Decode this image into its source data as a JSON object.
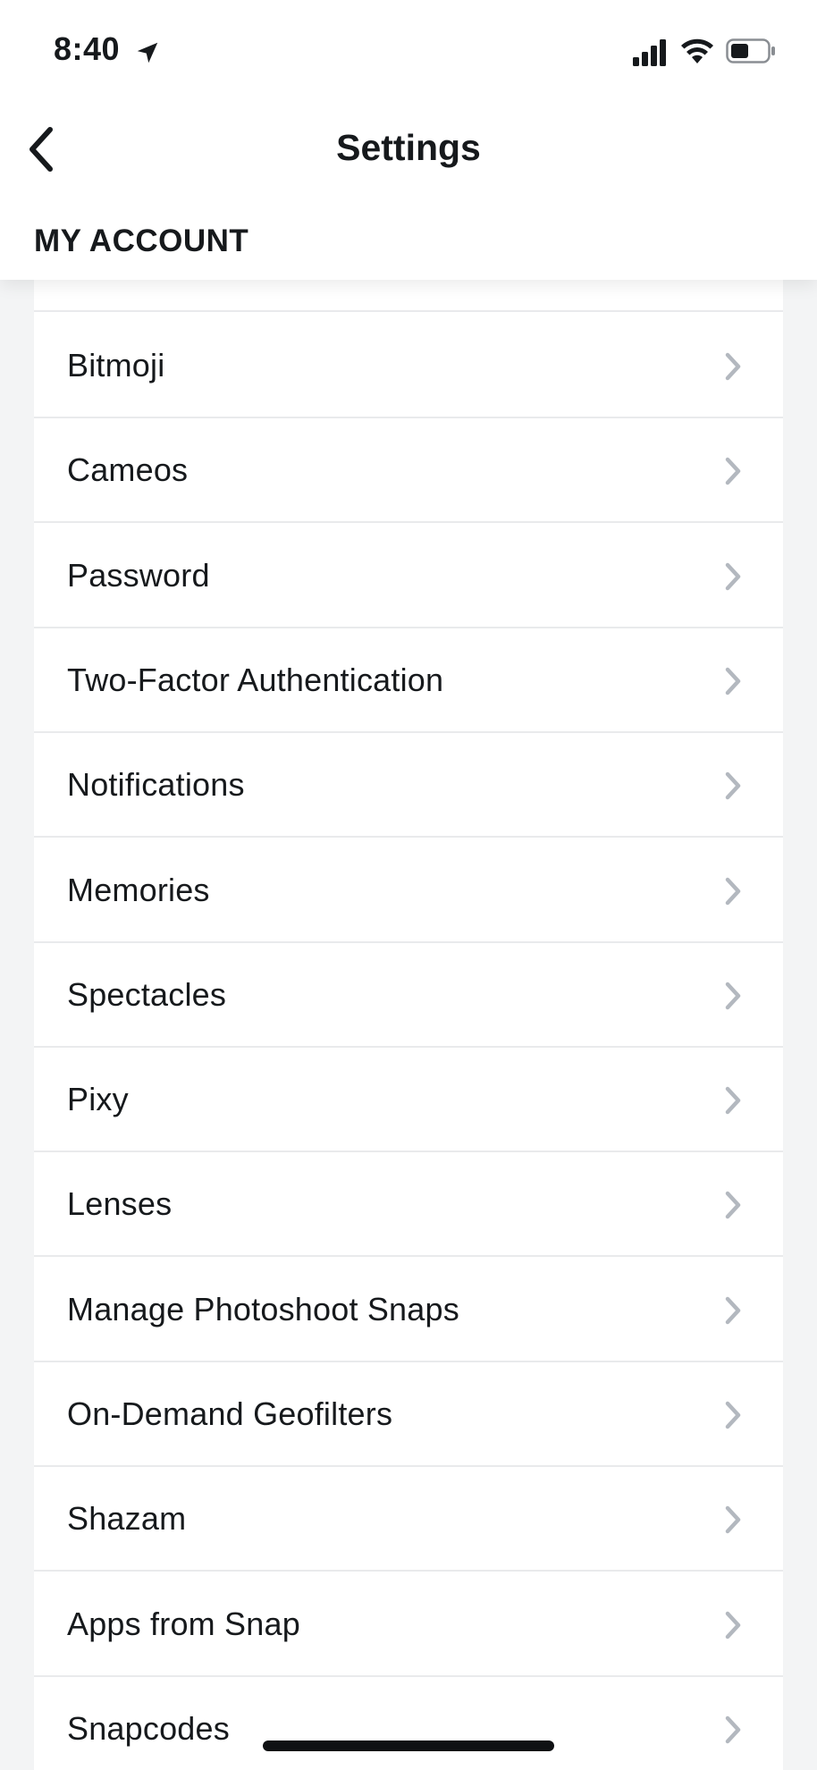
{
  "status_bar": {
    "time": "8:40"
  },
  "nav": {
    "title": "Settings",
    "back_icon": "chevron-left-icon"
  },
  "section": {
    "title": "MY ACCOUNT"
  },
  "items": [
    {
      "label": "Bitmoji"
    },
    {
      "label": "Cameos"
    },
    {
      "label": "Password"
    },
    {
      "label": "Two-Factor Authentication"
    },
    {
      "label": "Notifications"
    },
    {
      "label": "Memories"
    },
    {
      "label": "Spectacles"
    },
    {
      "label": "Pixy"
    },
    {
      "label": "Lenses"
    },
    {
      "label": "Manage Photoshoot Snaps"
    },
    {
      "label": "On-Demand Geofilters"
    },
    {
      "label": "Shazam"
    },
    {
      "label": "Apps from Snap"
    },
    {
      "label": "Snapcodes"
    }
  ],
  "colors": {
    "background": "#f3f4f5",
    "card": "#ffffff",
    "chevron": "#b3b8bf",
    "text": "#16191c"
  }
}
